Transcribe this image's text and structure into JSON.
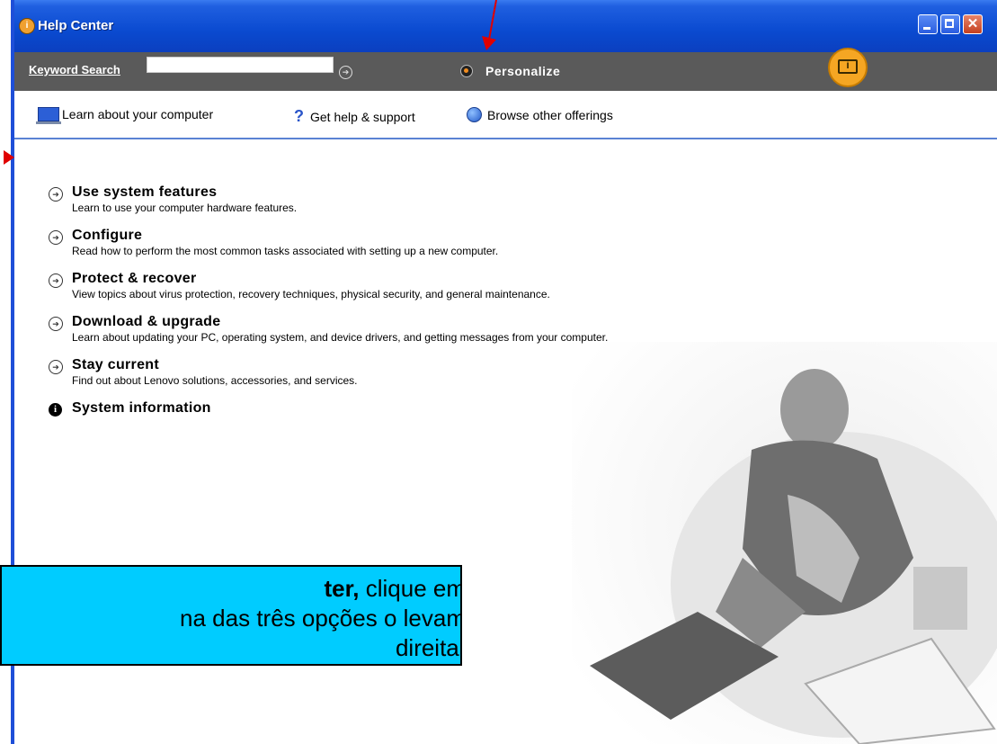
{
  "window": {
    "title": "Help Center"
  },
  "searchbar": {
    "keyword_label": "Keyword Search",
    "keyword_value": "",
    "personalize_label": "Personalize"
  },
  "navbar": {
    "learn_label": "Learn about your computer",
    "help_label": "Get help & support",
    "browse_label": "Browse other offerings"
  },
  "menu": {
    "items": [
      {
        "title": "Use system features",
        "desc": "Learn to use your computer hardware features."
      },
      {
        "title": "Configure",
        "desc": "Read how to perform the most common tasks associated with setting up a new computer."
      },
      {
        "title": "Protect & recover",
        "desc": "View topics about virus protection, recovery techniques, physical security, and general maintenance."
      },
      {
        "title": "Download & upgrade",
        "desc": "Learn about updating your PC, operating system, and device drivers, and getting messages from your computer."
      },
      {
        "title": "Stay current",
        "desc": "Find out about Lenovo solutions, accessories, and services."
      }
    ],
    "sysinfo_label": "System information"
  },
  "callout": {
    "line1_bold": "ter,",
    "line1_rest": " clique em",
    "line2": "na das três opções o levam",
    "line3": "direita."
  },
  "colors": {
    "titlebar": "#0a4ad0",
    "searchbar": "#5a5a5a",
    "callout_bg": "#00ccff",
    "annotation_arrow": "#e00000",
    "accent_orange": "#f5a623"
  }
}
